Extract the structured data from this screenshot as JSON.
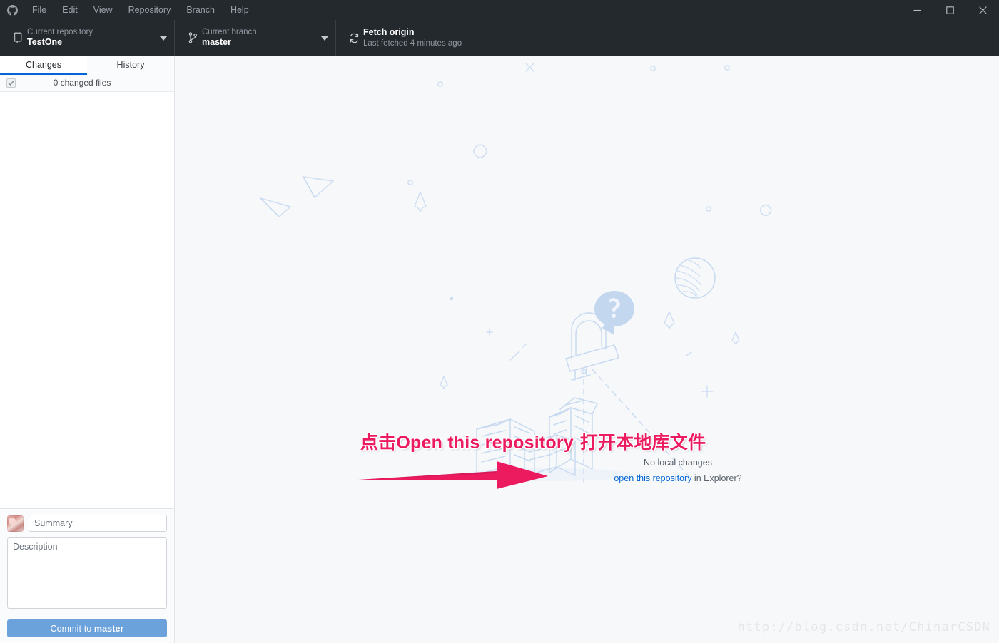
{
  "window": {
    "app_icon": "github-logo-icon",
    "menus": [
      "File",
      "Edit",
      "View",
      "Repository",
      "Branch",
      "Help"
    ],
    "controls": {
      "minimize": "minimize-icon",
      "maximize": "maximize-icon",
      "close": "close-icon"
    },
    "titlebar_bg": "#24292e"
  },
  "toolbar": {
    "repository": {
      "icon": "repo-book-icon",
      "label": "Current repository",
      "value": "TestOne",
      "caret": "chevron-down-icon"
    },
    "branch": {
      "icon": "branch-icon",
      "label": "Current branch",
      "value": "master",
      "caret": "chevron-down-icon"
    },
    "fetch": {
      "icon": "sync-icon",
      "title": "Fetch origin",
      "subtitle": "Last fetched 4 minutes ago"
    }
  },
  "sidebar": {
    "tabs": [
      {
        "label": "Changes",
        "active": true
      },
      {
        "label": "History",
        "active": false
      }
    ],
    "changes_header": {
      "checkbox_state": "checked",
      "label": "0 changed files"
    },
    "commit": {
      "avatar": "user-avatar",
      "summary_placeholder": "Summary",
      "summary_value": "",
      "description_placeholder": "Description",
      "description_value": "",
      "button_prefix": "Commit to ",
      "button_branch": "master",
      "button_color": "#6ca2dc"
    }
  },
  "main": {
    "empty_state": {
      "illustration": "no-local-changes-illustration",
      "no_changes_text": "No local changes",
      "open_link_text": "open this repository",
      "open_suffix_text": " in Explorer?",
      "link_color": "#0366d6"
    }
  },
  "annotations": {
    "callout": {
      "prefix_zh": "点击",
      "emphasis_en": "Open this repository",
      "suffix_zh": " 打开本地库文件",
      "full_text": "点击Open this repository 打开本地库文件",
      "color": "#ec1a5e"
    },
    "arrow": {
      "name": "red-arrow-annotation",
      "color": "#ec1a5e",
      "direction": "right"
    }
  },
  "watermark": {
    "text": "http://blog.csdn.net/ChinarCSDN"
  }
}
